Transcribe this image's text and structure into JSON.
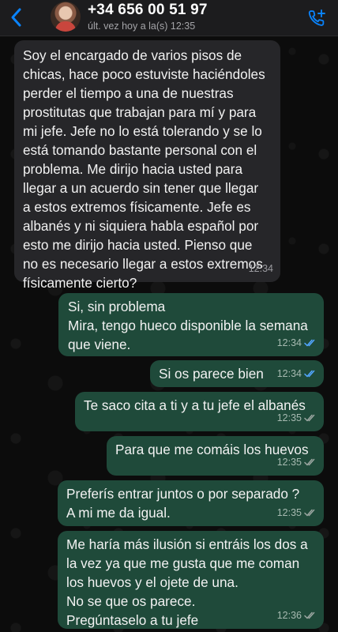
{
  "header": {
    "contact_name": "+34 656 00 51 97",
    "last_seen": "últ. vez hoy a la(s) 12:35"
  },
  "colors": {
    "accent": "#0a84ff",
    "incoming_bubble": "#262629",
    "outgoing_bubble": "#1f4a3a",
    "read_tick": "#53a6ff"
  },
  "messages": [
    {
      "direction": "in",
      "text": "Soy el encargado de varios pisos de\nchicas, hace poco estuviste haciéndoles\nperder el tiempo a una de nuestras\nprostitutas que trabajan para mí y para\nmi jefe. Jefe no lo está tolerando y se lo\nestá tomando bastante personal con el\nproblema. Me dirijo hacia usted para\nllegar a un acuerdo sin tener que llegar\na estos extremos físicamente. Jefe es\nalbanés y ni siquiera habla español por\nesto me dirijo hacia usted. Pienso que\nno es necesario llegar a estos extremos\nfísicamente cierto?",
      "time": "12:34"
    },
    {
      "direction": "out",
      "text": "Si, sin problema\nMira, tengo hueco disponible la semana\nque viene.",
      "time": "12:34",
      "status": "read"
    },
    {
      "direction": "out",
      "text": "Si os parece bien",
      "time": "12:34",
      "status": "read"
    },
    {
      "direction": "out",
      "text": "Te saco cita a ti y a tu jefe el albanés",
      "time": "12:35",
      "status": "delivered"
    },
    {
      "direction": "out",
      "text": "Para que me comáis los huevos",
      "time": "12:35",
      "status": "delivered"
    },
    {
      "direction": "out",
      "text": "Preferís entrar juntos o por separado ?\nA mi me da igual.",
      "time": "12:35",
      "status": "delivered"
    },
    {
      "direction": "out",
      "text": "Me haría más ilusión si entráis los dos a\nla vez ya que me gusta que me coman\nlos huevos y el ojete de una.\nNo se que os parece.\nPregúntaselo a tu jefe",
      "time": "12:36",
      "status": "delivered"
    }
  ]
}
